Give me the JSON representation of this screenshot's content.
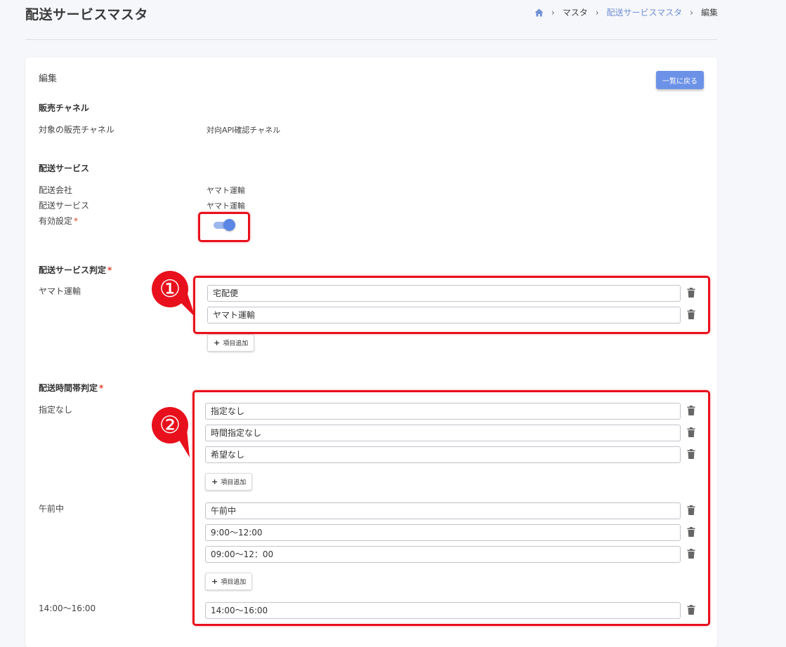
{
  "header": {
    "title": "配送サービスマスタ",
    "breadcrumb": {
      "home_icon": "home-icon",
      "items": [
        "マスタ",
        "配送サービスマスタ",
        "編集"
      ]
    }
  },
  "card": {
    "title": "編集",
    "back_button": "一覧に戻る",
    "sales_channel": {
      "section": "販売チャネル",
      "label": "対象の販売チャネル",
      "value": "対向API確認チャネル"
    },
    "delivery_service": {
      "section": "配送サービス",
      "company_label": "配送会社",
      "company_value": "ヤマト運輸",
      "service_label": "配送サービス",
      "service_value": "ヤマト運輸",
      "enabled_label": "有効設定",
      "required_mark": "*",
      "enabled": true
    },
    "service_judgement": {
      "section": "配送サービス判定",
      "required_mark": "*",
      "label": "ヤマト運輸",
      "values": [
        "宅配便",
        "ヤマト運輸"
      ],
      "add_button": "項目追加"
    },
    "time_judgement": {
      "section": "配送時間帯判定",
      "required_mark": "*",
      "groups": [
        {
          "label": "指定なし",
          "values": [
            "指定なし",
            "時間指定なし",
            "希望なし"
          ],
          "add_button": "項目追加"
        },
        {
          "label": "午前中",
          "values": [
            "午前中",
            "9:00～12:00",
            "09:00～12：00"
          ],
          "add_button": "項目追加"
        },
        {
          "label": "14:00～16:00",
          "values": [
            "14:00～16:00"
          ]
        }
      ]
    }
  },
  "annotations": {
    "callout_1": "①",
    "callout_2": "②"
  },
  "colors": {
    "accent": "#6c92e8",
    "highlight": "#e8101c",
    "required": "#e0452a"
  }
}
